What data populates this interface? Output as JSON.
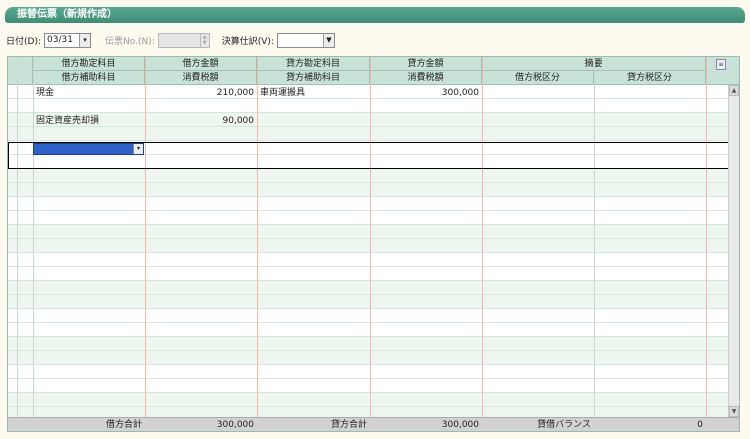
{
  "window": {
    "title": "振替伝票（新規作成）"
  },
  "toolbar": {
    "date_label": "日付(D):",
    "date_value": "03/31",
    "slip_no_label": "伝票No.(N):",
    "slip_no_value": "",
    "settlement_label": "決算仕訳(V):",
    "settlement_value": ""
  },
  "columns": {
    "debit_account": "借方勘定科目",
    "debit_amount": "借方金額",
    "credit_account": "貸方勘定科目",
    "credit_amount": "貸方金額",
    "summary": "摘要",
    "debit_sub": "借方補助科目",
    "debit_tax": "消費税額",
    "credit_sub": "貸方補助科目",
    "credit_tax": "消費税額",
    "debit_tax_class": "借方税区分",
    "credit_tax_class": "貸方税区分"
  },
  "rows": [
    {
      "debit_account": "現金",
      "debit_amount": "210,000",
      "credit_account": "車両運搬具",
      "credit_amount": "300,000"
    },
    {
      "debit_account": "固定資産売却損",
      "debit_amount": "90,000",
      "credit_account": "",
      "credit_amount": ""
    }
  ],
  "footer": {
    "debit_total_label": "借方合計",
    "debit_total": "300,000",
    "credit_total_label": "貸方合計",
    "credit_total": "300,000",
    "balance_label": "貸借バランス",
    "balance": "0"
  }
}
